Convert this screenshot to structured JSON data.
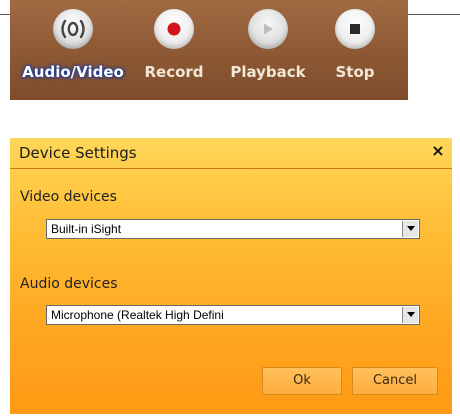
{
  "toolbar": {
    "items": [
      {
        "label": "Audio/Video",
        "icon": "audio-video-icon",
        "selected": true
      },
      {
        "label": "Record",
        "icon": "record-dot-icon"
      },
      {
        "label": "Playback",
        "icon": "play-triangle-icon"
      },
      {
        "label": "Stop",
        "icon": "stop-square-icon"
      }
    ]
  },
  "dialog": {
    "title": "Device Settings",
    "close_label": "×",
    "video": {
      "label": "Video devices",
      "selected": "Built-in iSight"
    },
    "audio": {
      "label": "Audio devices",
      "selected": "Microphone (Realtek High Defini"
    },
    "ok_label": "Ok",
    "cancel_label": "Cancel"
  },
  "colors": {
    "toolbar_bg": "#8e5a35",
    "record_dot": "#d4141e",
    "dialog_top": "#ffd75a",
    "dialog_bottom": "#ff9a14"
  }
}
